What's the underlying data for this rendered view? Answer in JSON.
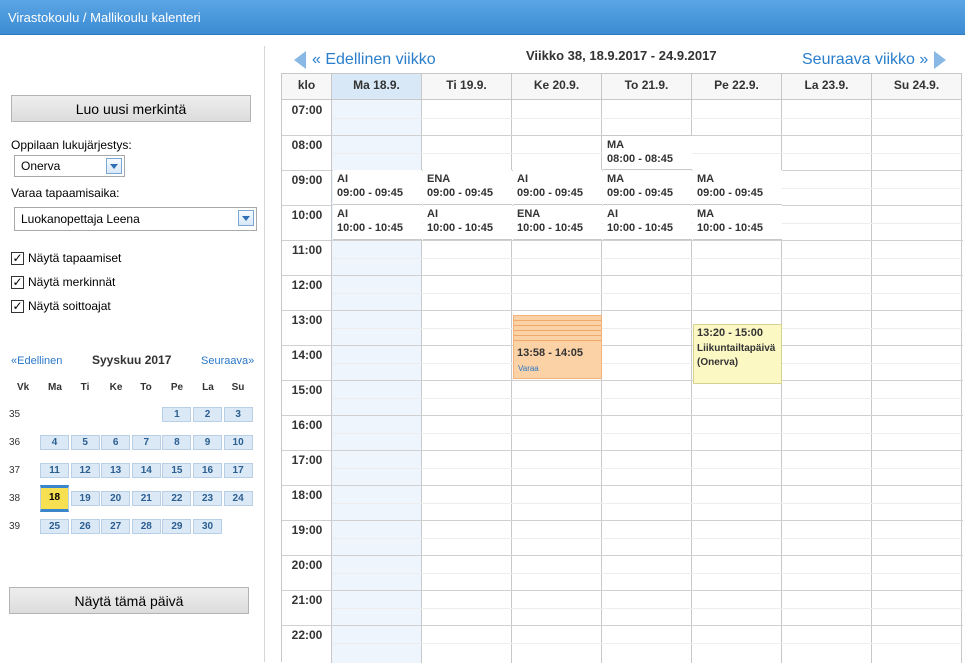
{
  "header": {
    "title": "Virastokoulu / Mallikoulu kalenteri"
  },
  "sidebar": {
    "new_entry_label": "Luo uusi merkintä",
    "schedule_label": "Oppilaan lukujärjestys:",
    "schedule_value": "Onerva",
    "booking_label": "Varaa tapaamisaika:",
    "booking_value": "Luokanopettaja Leena",
    "checkboxes": [
      {
        "label": "Näytä tapaamiset",
        "checked": true
      },
      {
        "label": "Näytä merkinnät",
        "checked": true
      },
      {
        "label": "Näytä soittoajat",
        "checked": true
      }
    ],
    "mini_calendar": {
      "prev_label": "«Edellinen",
      "next_label": "Seuraava»",
      "month_title": "Syyskuu 2017",
      "headers": [
        "Vk",
        "Ma",
        "Ti",
        "Ke",
        "To",
        "Pe",
        "La",
        "Su"
      ],
      "weeks": [
        {
          "week": "35",
          "days": [
            "",
            "",
            "",
            "",
            "1",
            "2",
            "3"
          ]
        },
        {
          "week": "36",
          "days": [
            "4",
            "5",
            "6",
            "7",
            "8",
            "9",
            "10"
          ]
        },
        {
          "week": "37",
          "days": [
            "11",
            "12",
            "13",
            "14",
            "15",
            "16",
            "17"
          ]
        },
        {
          "week": "38",
          "days": [
            "18",
            "19",
            "20",
            "21",
            "22",
            "23",
            "24"
          ]
        },
        {
          "week": "39",
          "days": [
            "25",
            "26",
            "27",
            "28",
            "29",
            "30",
            ""
          ]
        }
      ],
      "today": "18"
    },
    "show_today_label": "Näytä tämä päivä"
  },
  "calendar": {
    "prev_week_label": "« Edellinen viikko",
    "next_week_label": "Seuraava viikko »",
    "week_title": "Viikko 38, 18.9.2017 - 24.9.2017",
    "time_header": "klo",
    "days": [
      "Ma 18.9.",
      "Ti 19.9.",
      "Ke 20.9.",
      "To 21.9.",
      "Pe 22.9.",
      "La 23.9.",
      "Su 24.9."
    ],
    "today_index": 0,
    "hours": [
      "07:00",
      "08:00",
      "09:00",
      "10:00",
      "11:00",
      "12:00",
      "13:00",
      "14:00",
      "15:00",
      "16:00",
      "17:00",
      "18:00",
      "19:00",
      "20:00",
      "21:00",
      "22:00"
    ],
    "lessons": [
      {
        "day": 3,
        "subject": "MA",
        "time": "08:00 - 08:45"
      },
      {
        "day": 0,
        "subject": "AI",
        "time": "09:00 - 09:45"
      },
      {
        "day": 1,
        "subject": "ENA",
        "time": "09:00 - 09:45"
      },
      {
        "day": 2,
        "subject": "AI",
        "time": "09:00 - 09:45"
      },
      {
        "day": 3,
        "subject": "MA",
        "time": "09:00 - 09:45"
      },
      {
        "day": 4,
        "subject": "MA",
        "time": "09:00 - 09:45"
      },
      {
        "day": 0,
        "subject": "AI",
        "time": "10:00 - 10:45"
      },
      {
        "day": 1,
        "subject": "AI",
        "time": "10:00 - 10:45"
      },
      {
        "day": 2,
        "subject": "ENA",
        "time": "10:00 - 10:45"
      },
      {
        "day": 3,
        "subject": "AI",
        "time": "10:00 - 10:45"
      },
      {
        "day": 4,
        "subject": "MA",
        "time": "10:00 - 10:45"
      }
    ],
    "booking_slot": {
      "day": 2,
      "time": "13:58 - 14:05",
      "action": "Varaa"
    },
    "event": {
      "day": 4,
      "time": "13:20 - 15:00",
      "title": "Liikuntailtapäivä",
      "who": "(Onerva)"
    },
    "colors": {
      "today_column": "#eef5fd",
      "booking": "#fbd2a6",
      "event": "#fbf8c4",
      "accent": "#2a7ecb"
    }
  }
}
